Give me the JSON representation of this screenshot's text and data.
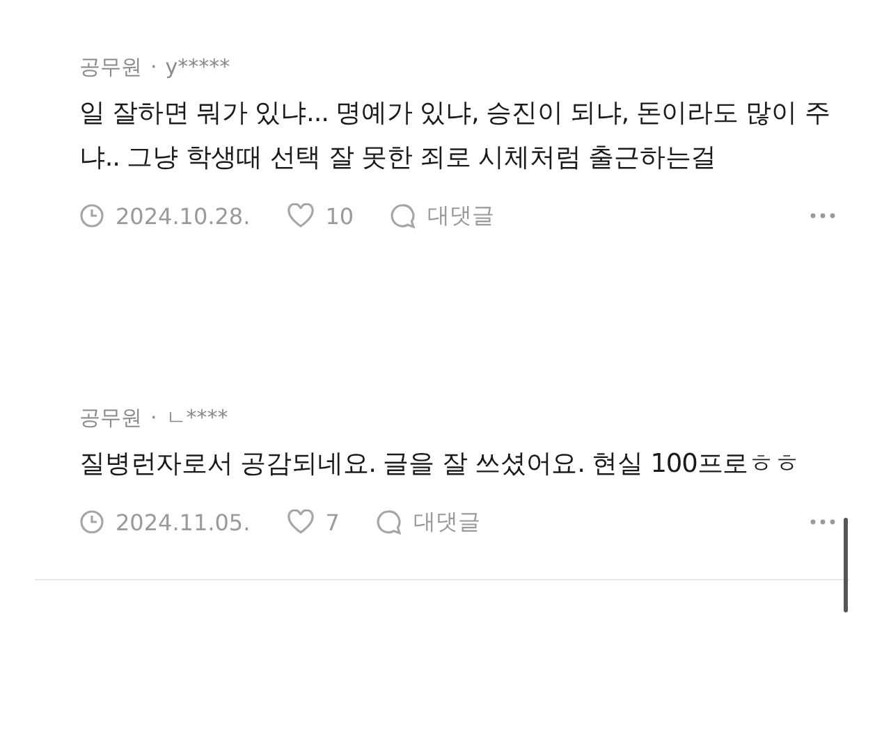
{
  "comments": [
    {
      "category": "공무원",
      "separator": "·",
      "author": "y*****",
      "text": "일 잘하면 뭐가 있냐... 명예가 있냐, 승진이 되냐, 돈이라도 많이 주냐.. 그냥 학생때 선택 잘 못한 죄로 시체처럼 출근하는걸",
      "date": "2024.10.28.",
      "likes": "10",
      "reply": "대댓글"
    },
    {
      "category": "공무원",
      "separator": "·",
      "author": "ㄴ****",
      "text": "질병런자로서 공감되네요. 글을 잘 쓰셨어요. 현실 100프로ㅎㅎ",
      "date": "2024.11.05.",
      "likes": "7",
      "reply": "대댓글"
    }
  ]
}
